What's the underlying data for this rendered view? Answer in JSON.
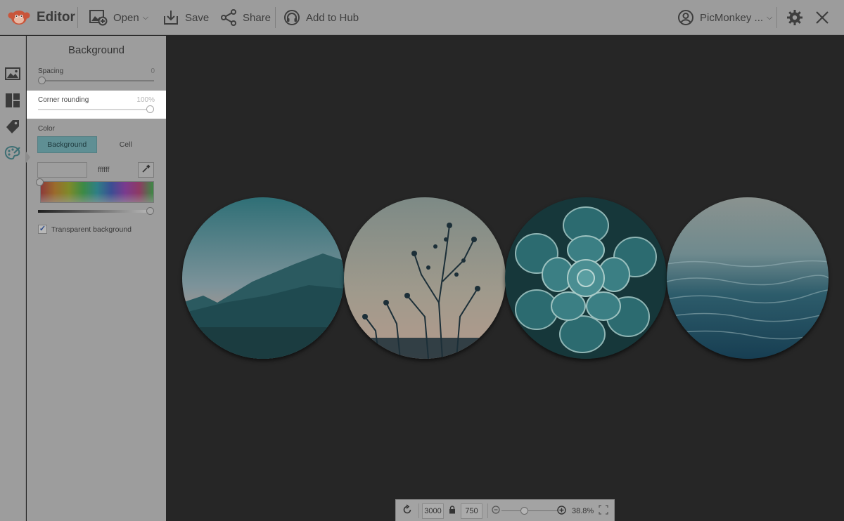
{
  "topbar": {
    "brand_label": "Editor",
    "open_label": "Open",
    "save_label": "Save",
    "share_label": "Share",
    "hub_label": "Add to Hub",
    "user_label": "PicMonkey ...",
    "icons": [
      "monkey-logo-icon",
      "open-image-icon",
      "save-download-icon",
      "share-icon",
      "hub-headphones-icon",
      "user-avatar-icon",
      "gear-icon",
      "close-icon"
    ]
  },
  "rail": {
    "items": [
      "image-icon",
      "layout-icon",
      "tag-icon",
      "palette-icon"
    ],
    "active": "palette-icon"
  },
  "panel": {
    "title": "Background",
    "spacing": {
      "label": "Spacing",
      "value": "0"
    },
    "corner_rounding": {
      "label": "Corner rounding",
      "value": "100%"
    },
    "color": {
      "label": "Color",
      "tabs": [
        "Background",
        "Cell"
      ],
      "active_tab": "Background",
      "hex": "ffffff",
      "transparent_label": "Transparent background",
      "transparent_checked": true
    }
  },
  "canvas": {
    "photos": [
      "mountain-landscape-photo",
      "wildflower-silhouette-photo",
      "succulent-rosette-photo",
      "ocean-water-photo"
    ],
    "background": "#262626"
  },
  "bottombar": {
    "width": "3000",
    "height": "750",
    "zoom": "38.8%"
  },
  "colors": {
    "accent": "#5f8f94",
    "highlight": "#ffffff"
  }
}
